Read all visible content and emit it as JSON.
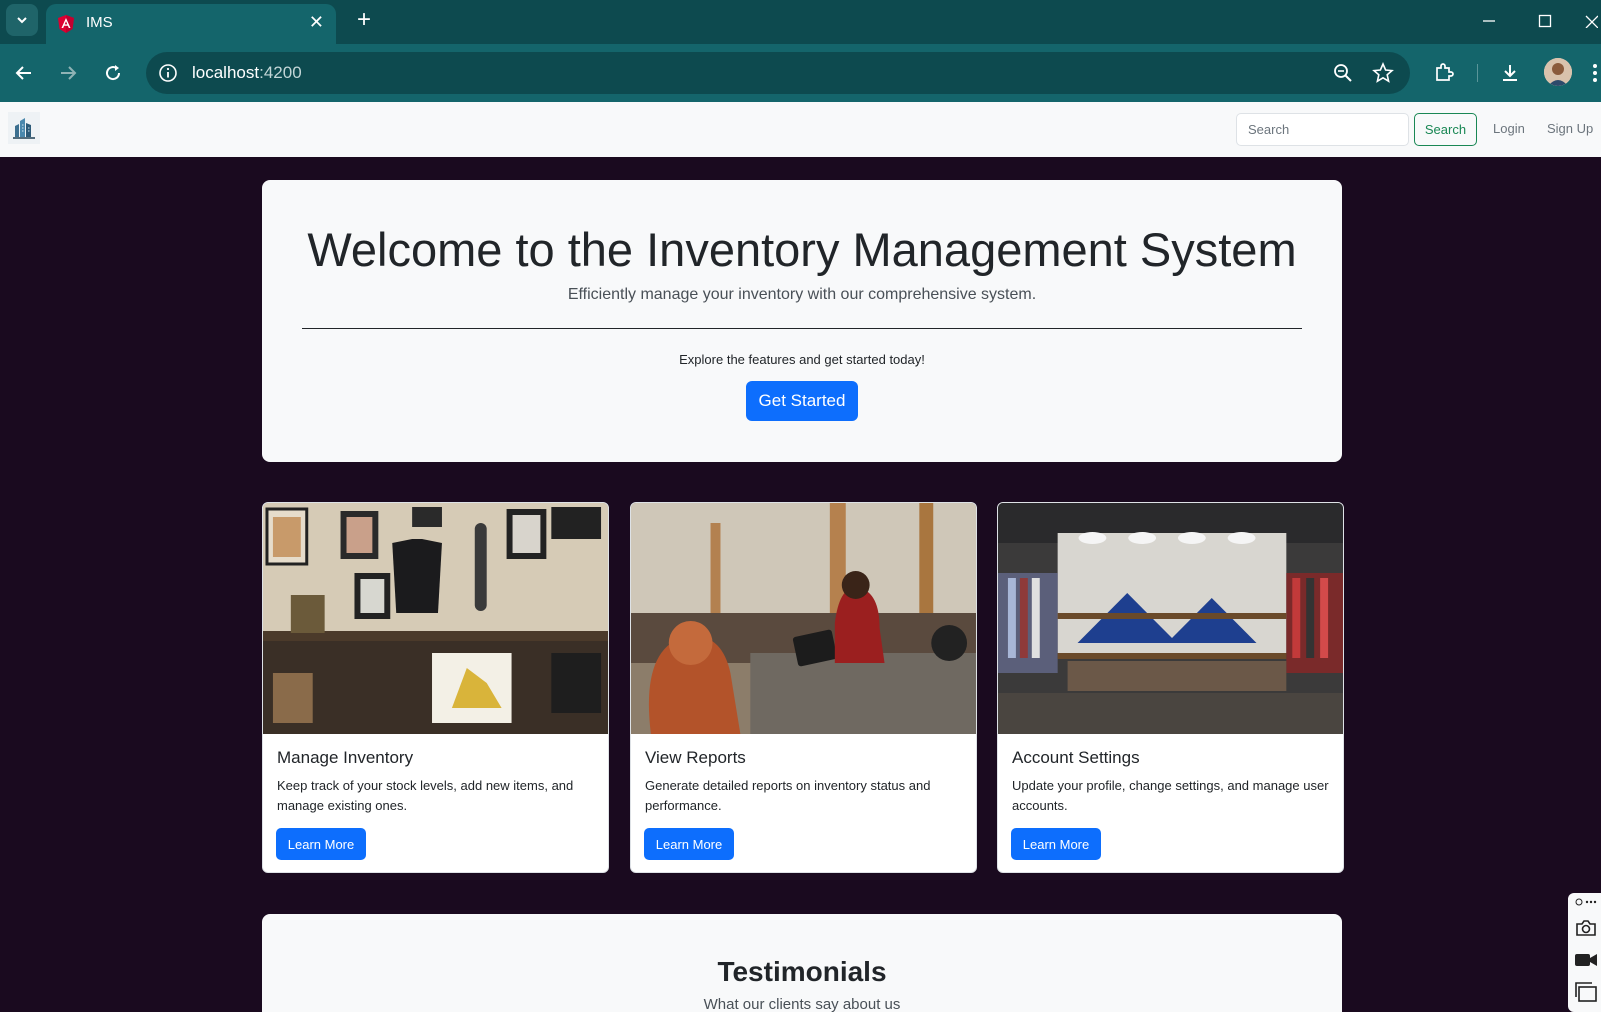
{
  "browser": {
    "tab_title": "IMS",
    "url_host": "localhost",
    "url_port": ":4200"
  },
  "navbar": {
    "search_placeholder": "Search",
    "search_button": "Search",
    "login": "Login",
    "signup": "Sign Up"
  },
  "hero": {
    "title": "Welcome to the Inventory Management System",
    "subtitle": "Efficiently manage your inventory with our comprehensive system.",
    "text": "Explore the features and get started today!",
    "button": "Get Started"
  },
  "cards": [
    {
      "title": "Manage Inventory",
      "text": "Keep track of your stock levels, add new items, and manage existing ones.",
      "button": "Learn More"
    },
    {
      "title": "View Reports",
      "text": "Generate detailed reports on inventory status and performance.",
      "button": "Learn More"
    },
    {
      "title": "Account Settings",
      "text": "Update your profile, change settings, and manage user accounts.",
      "button": "Learn More"
    }
  ],
  "testimonials": {
    "title": "Testimonials",
    "subtitle": "What our clients say about us"
  },
  "colors": {
    "page_bg": "#1a0a1f",
    "chrome": "#14656b",
    "primary": "#0d6efd",
    "success": "#198754"
  }
}
